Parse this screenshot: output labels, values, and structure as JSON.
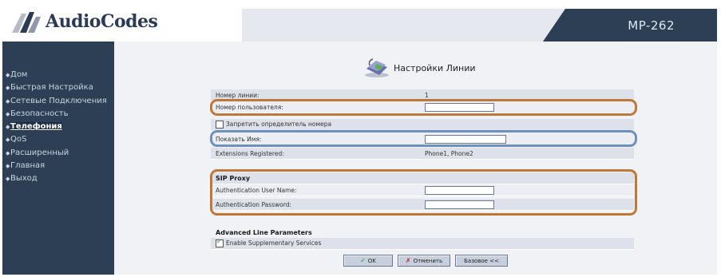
{
  "header": {
    "brand": "AudioCodes",
    "model": "MP-262"
  },
  "sidebar": {
    "items": [
      {
        "label": "Дом"
      },
      {
        "label": "Быстрая Настройка"
      },
      {
        "label": "Сетевые Подключения"
      },
      {
        "label": "Безопасность"
      },
      {
        "label": "Телефония",
        "active": true
      },
      {
        "label": "QoS"
      },
      {
        "label": "Расширенный"
      },
      {
        "label": "Главная"
      },
      {
        "label": "Выход"
      }
    ]
  },
  "page": {
    "title": "Настройки Линии",
    "icon": "phone-icon",
    "line_number_label": "Номер линии:",
    "line_number_value": "1",
    "user_number_label": "Номер пользователя:",
    "user_number_value": "",
    "block_caller_id_label": "Запретить определитель номера",
    "block_caller_id_checked": false,
    "display_name_label": "Показать Имя:",
    "display_name_value": "",
    "extensions_label": "Extensions Registered:",
    "extensions_value": "Phone1, Phone2",
    "sip_proxy_header": "SIP Proxy",
    "auth_user_label": "Authentication User Name:",
    "auth_user_value": "",
    "auth_password_label": "Authentication Password:",
    "auth_password_value": "",
    "advanced_header": "Advanced Line Parameters",
    "supplementary_label": "Enable Supplementary Services",
    "supplementary_checked": true
  },
  "buttons": {
    "ok": "OK",
    "cancel": "Отменить",
    "basic": "Базовое <<"
  },
  "colors": {
    "sidebar": "#2c3f55",
    "highlight_orange": "#c0783a",
    "highlight_blue": "#6f8fbd"
  }
}
